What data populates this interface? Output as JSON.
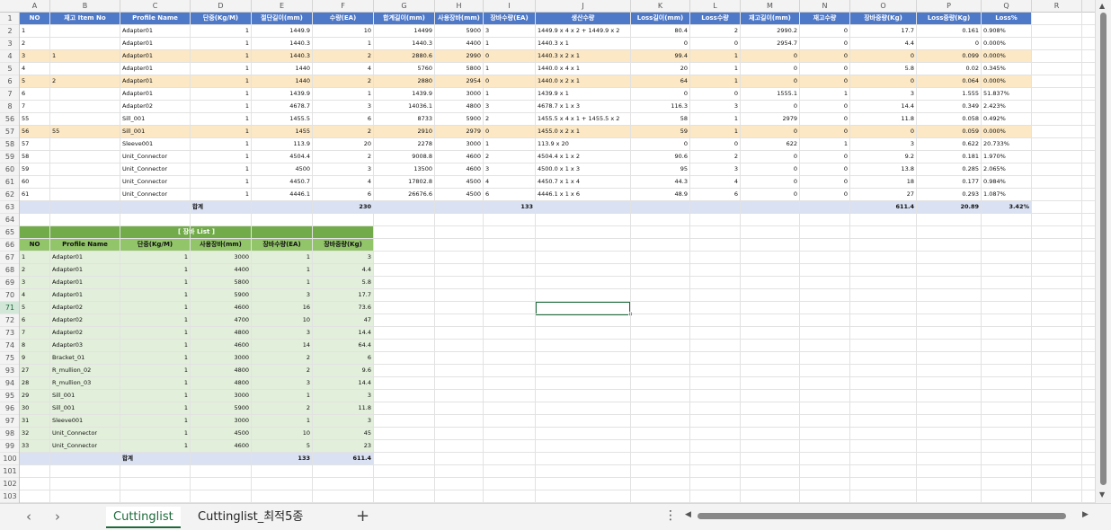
{
  "columns": [
    "A",
    "B",
    "C",
    "D",
    "E",
    "F",
    "G",
    "H",
    "I",
    "J",
    "K",
    "L",
    "M",
    "N",
    "O",
    "P",
    "Q",
    "R"
  ],
  "row_numbers": [
    "1",
    "2",
    "3",
    "4",
    "5",
    "6",
    "7",
    "8",
    "56",
    "57",
    "58",
    "59",
    "60",
    "61",
    "62",
    "63",
    "64",
    "65",
    "66",
    "67",
    "68",
    "69",
    "70",
    "71",
    "72",
    "73",
    "74",
    "75",
    "93",
    "94",
    "95",
    "96",
    "97",
    "98",
    "99",
    "100",
    "101",
    "102",
    "103"
  ],
  "selected_row": "71",
  "main_headers": [
    "NO",
    "재고 Item No",
    "Profile Name",
    "단중(Kg/M)",
    "절단길이(mm)",
    "수량(EA)",
    "합계길이(mm)",
    "사용장바(mm)",
    "장바수량(EA)",
    "생산수량",
    "Loss길이(mm)",
    "Loss수량",
    "재고길이(mm)",
    "재고수량",
    "장바중량(Kg)",
    "Loss중량(Kg)",
    "Loss%"
  ],
  "main_rows": [
    [
      "1",
      "",
      "Adapter01",
      "1",
      "1449.9",
      "10",
      "14499",
      "5900",
      "3",
      "1449.9 x 4 x 2  +  1449.9 x 2",
      "80.4",
      "2",
      "2990.2",
      "0",
      "17.7",
      "0.161",
      "0.908%"
    ],
    [
      "2",
      "",
      "Adapter01",
      "1",
      "1440.3",
      "1",
      "1440.3",
      "4400",
      "1",
      "1440.3 x 1",
      "0",
      "0",
      "2954.7",
      "0",
      "4.4",
      "0",
      "0.000%"
    ],
    [
      "3",
      "1",
      "Adapter01",
      "1",
      "1440.3",
      "2",
      "2880.6",
      "2990",
      "0",
      "1440.3 x 2 x 1",
      "99.4",
      "1",
      "0",
      "0",
      "0",
      "0.099",
      "0.000%"
    ],
    [
      "4",
      "",
      "Adapter01",
      "1",
      "1440",
      "4",
      "5760",
      "5800",
      "1",
      "1440.0 x 4 x 1",
      "20",
      "1",
      "0",
      "0",
      "5.8",
      "0.02",
      "0.345%"
    ],
    [
      "5",
      "2",
      "Adapter01",
      "1",
      "1440",
      "2",
      "2880",
      "2954",
      "0",
      "1440.0 x 2 x 1",
      "64",
      "1",
      "0",
      "0",
      "0",
      "0.064",
      "0.000%"
    ],
    [
      "6",
      "",
      "Adapter01",
      "1",
      "1439.9",
      "1",
      "1439.9",
      "3000",
      "1",
      "1439.9 x 1",
      "0",
      "0",
      "1555.1",
      "1",
      "3",
      "1.555",
      "51.837%"
    ],
    [
      "7",
      "",
      "Adapter02",
      "1",
      "4678.7",
      "3",
      "14036.1",
      "4800",
      "3",
      "4678.7 x 1 x 3",
      "116.3",
      "3",
      "0",
      "0",
      "14.4",
      "0.349",
      "2.423%"
    ],
    [
      "55",
      "",
      "Sill_001",
      "1",
      "1455.5",
      "6",
      "8733",
      "5900",
      "2",
      "1455.5 x 4 x 1  +  1455.5 x 2",
      "58",
      "1",
      "2979",
      "0",
      "11.8",
      "0.058",
      "0.492%"
    ],
    [
      "56",
      "55",
      "Sill_001",
      "1",
      "1455",
      "2",
      "2910",
      "2979",
      "0",
      "1455.0 x 2 x 1",
      "59",
      "1",
      "0",
      "0",
      "0",
      "0.059",
      "0.000%"
    ],
    [
      "57",
      "",
      "Sleeve001",
      "1",
      "113.9",
      "20",
      "2278",
      "3000",
      "1",
      "113.9 x 20",
      "0",
      "0",
      "622",
      "1",
      "3",
      "0.622",
      "20.733%"
    ],
    [
      "58",
      "",
      "Unit_Connector",
      "1",
      "4504.4",
      "2",
      "9008.8",
      "4600",
      "2",
      "4504.4 x 1 x 2",
      "90.6",
      "2",
      "0",
      "0",
      "9.2",
      "0.181",
      "1.970%"
    ],
    [
      "59",
      "",
      "Unit_Connector",
      "1",
      "4500",
      "3",
      "13500",
      "4600",
      "3",
      "4500.0 x 1 x 3",
      "95",
      "3",
      "0",
      "0",
      "13.8",
      "0.285",
      "2.065%"
    ],
    [
      "60",
      "",
      "Unit_Connector",
      "1",
      "4450.7",
      "4",
      "17802.8",
      "4500",
      "4",
      "4450.7 x 1 x 4",
      "44.3",
      "4",
      "0",
      "0",
      "18",
      "0.177",
      "0.984%"
    ],
    [
      "61",
      "",
      "Unit_Connector",
      "1",
      "4446.1",
      "6",
      "26676.6",
      "4500",
      "6",
      "4446.1 x 1 x 6",
      "48.9",
      "6",
      "0",
      "0",
      "27",
      "0.293",
      "1.087%"
    ]
  ],
  "main_total": {
    "label": "합계",
    "qty": "230",
    "bars": "133",
    "weight": "611.4",
    "loss_weight": "20.89",
    "loss_pct": "3.42%"
  },
  "list_title": "[ 장바 List ]",
  "list_headers": [
    "NO",
    "Profile Name",
    "단중(Kg/M)",
    "사용장바(mm)",
    "장바수량(EA)",
    "장바중량(Kg)"
  ],
  "list_rows": [
    [
      "1",
      "Adapter01",
      "1",
      "3000",
      "1",
      "3"
    ],
    [
      "2",
      "Adapter01",
      "1",
      "4400",
      "1",
      "4.4"
    ],
    [
      "3",
      "Adapter01",
      "1",
      "5800",
      "1",
      "5.8"
    ],
    [
      "4",
      "Adapter01",
      "1",
      "5900",
      "3",
      "17.7"
    ],
    [
      "5",
      "Adapter02",
      "1",
      "4600",
      "16",
      "73.6"
    ],
    [
      "6",
      "Adapter02",
      "1",
      "4700",
      "10",
      "47"
    ],
    [
      "7",
      "Adapter02",
      "1",
      "4800",
      "3",
      "14.4"
    ],
    [
      "8",
      "Adapter03",
      "1",
      "4600",
      "14",
      "64.4"
    ],
    [
      "9",
      "Bracket_01",
      "1",
      "3000",
      "2",
      "6"
    ],
    [
      "27",
      "R_mullion_02",
      "1",
      "4800",
      "2",
      "9.6"
    ],
    [
      "28",
      "R_mullion_03",
      "1",
      "4800",
      "3",
      "14.4"
    ],
    [
      "29",
      "Sill_001",
      "1",
      "3000",
      "1",
      "3"
    ],
    [
      "30",
      "Sill_001",
      "1",
      "5900",
      "2",
      "11.8"
    ],
    [
      "31",
      "Sleeve001",
      "1",
      "3000",
      "1",
      "3"
    ],
    [
      "32",
      "Unit_Connector",
      "1",
      "4500",
      "10",
      "45"
    ],
    [
      "33",
      "Unit_Connector",
      "1",
      "4600",
      "5",
      "23"
    ]
  ],
  "list_total": {
    "label": "합계",
    "qty": "133",
    "weight": "611.4"
  },
  "tabs": {
    "sheet1": "Cuttinglist",
    "sheet2": "Cuttinglist_최적5종",
    "add": "+",
    "more": "⋮",
    "prev": "‹",
    "next": "›"
  },
  "scroll": {
    "up": "▲",
    "down": "▼",
    "left": "◀",
    "right": "▶"
  },
  "colors": {
    "header_blue": "#4e78c8",
    "highlight": "#fce8c4",
    "total_blue": "#d9e1f2",
    "list_green": "#72ac4a",
    "list_cell": "#e2efda",
    "excel_green": "#1d6b3b"
  }
}
